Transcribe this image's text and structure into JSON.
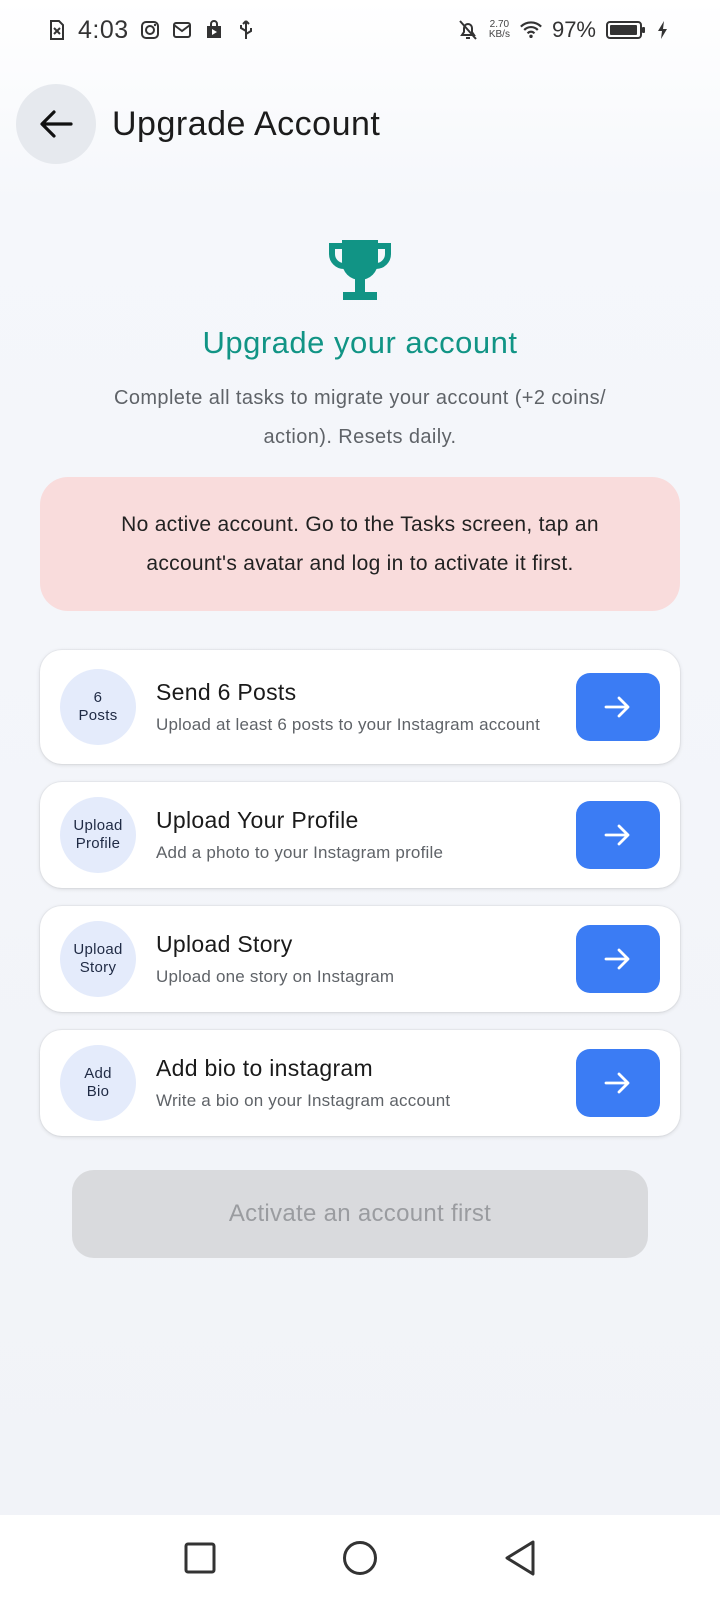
{
  "status_bar": {
    "time": "4:03",
    "net_speed_value": "2.70",
    "net_speed_unit": "KB/s",
    "battery_pct": "97%",
    "battery_level": 0.97
  },
  "header": {
    "title": "Upgrade Account"
  },
  "hero": {
    "title": "Upgrade your account",
    "subtitle": "Complete all tasks to migrate your account (+2 coins/ action). Resets daily."
  },
  "alert": {
    "message": "No active account. Go to the Tasks screen, tap an account's avatar and log in to activate it first."
  },
  "tasks": [
    {
      "badge": "6\nPosts",
      "title": "Send 6 Posts",
      "desc": "Upload at least 6 posts to your Instagram account"
    },
    {
      "badge": "Upload\nProfile",
      "title": "Upload Your Profile",
      "desc": "Add a photo to your Instagram profile"
    },
    {
      "badge": "Upload\nStory",
      "title": "Upload Story",
      "desc": "Upload one story on Instagram"
    },
    {
      "badge": "Add\nBio",
      "title": "Add bio to instagram",
      "desc": "Write a bio on your Instagram account"
    }
  ],
  "activate_button": {
    "label": "Activate an account first"
  },
  "colors": {
    "accent_teal": "#119485",
    "primary_blue": "#3b7cf4",
    "alert_bg": "#f9dcdc",
    "badge_bg": "#e4ebfb",
    "disabled_bg": "#d9dadd"
  }
}
